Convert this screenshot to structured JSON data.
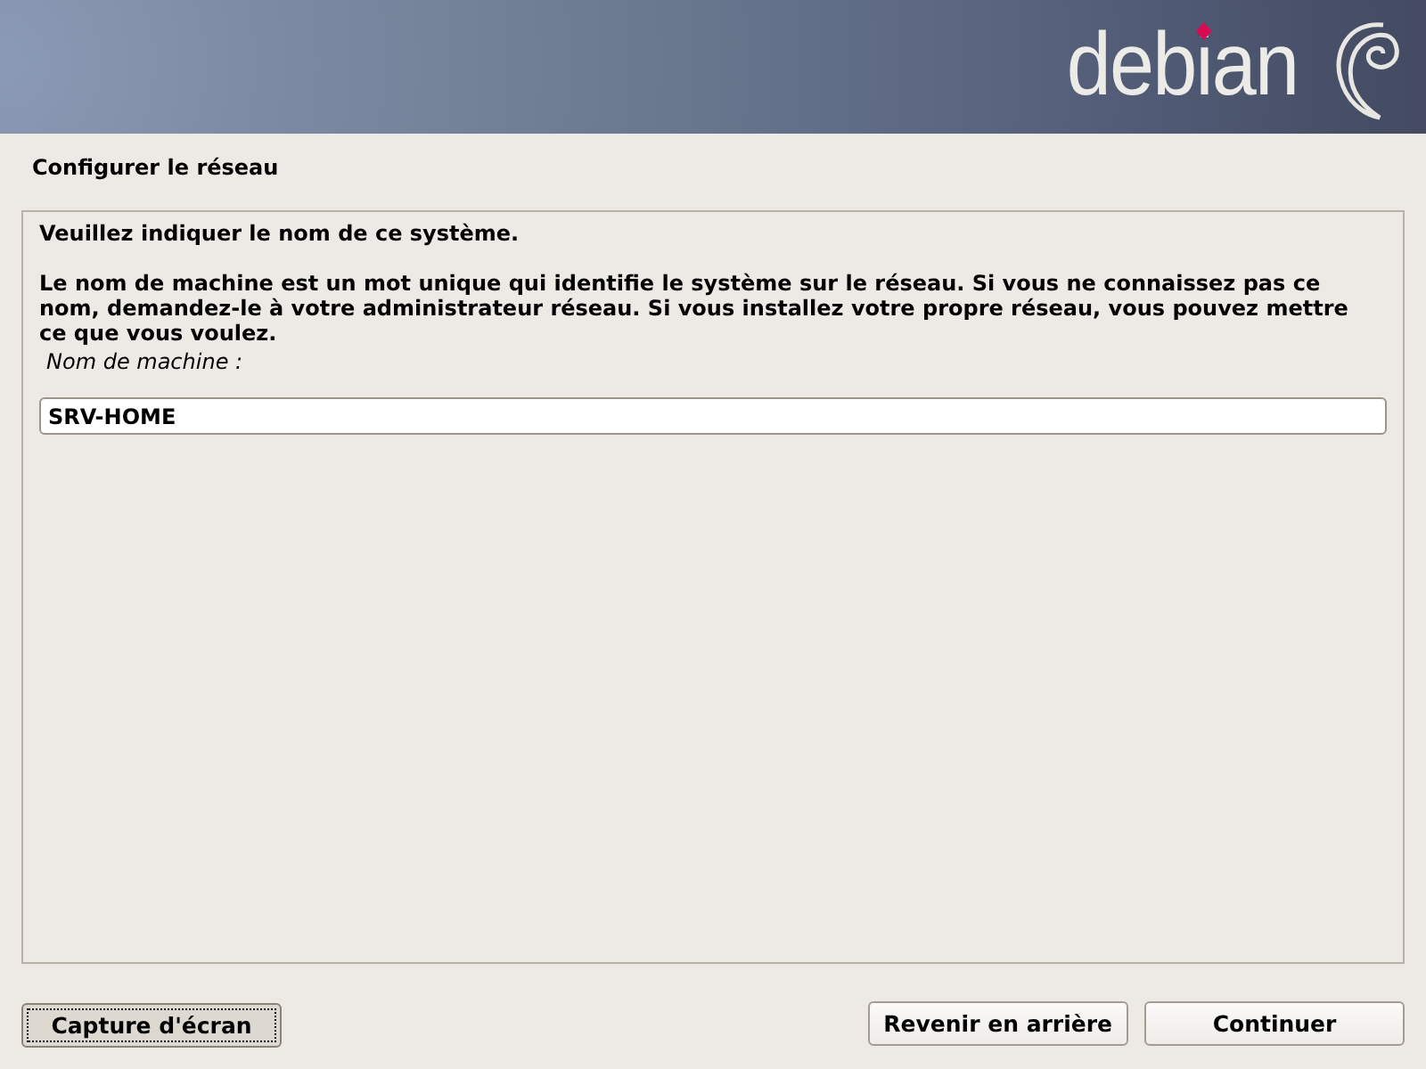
{
  "header": {
    "logo": "debian"
  },
  "title": "Configurer le réseau",
  "question": "Veuillez indiquer le nom de ce système.",
  "description": "Le nom de machine est un mot unique qui identifie le système sur le réseau. Si vous ne connaissez pas ce nom, demandez-le à votre administrateur réseau. Si vous installez votre propre réseau, vous pouvez mettre ce que vous voulez.",
  "field": {
    "label": "Nom de machine :",
    "value": "SRV-HOME"
  },
  "left_buttons": [
    {
      "label": "Capture d'écran",
      "focused": true
    }
  ],
  "right_buttons": [
    {
      "label": "Revenir en arrière",
      "focused": false
    },
    {
      "label": "Continuer",
      "focused": false
    }
  ]
}
